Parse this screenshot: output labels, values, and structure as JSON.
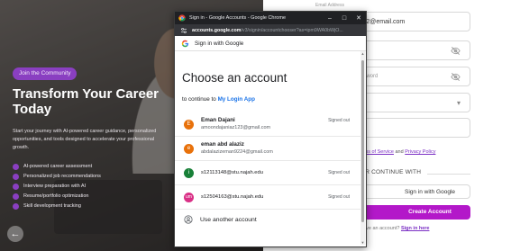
{
  "hero": {
    "badge": "Join the Community",
    "title": "Transform Your Career Today",
    "description": "Start your journey with AI-powered career guidance, personalized opportunities, and tools designed to accelerate your professional growth.",
    "features": [
      "AI-powered career assessment",
      "Personalized job recommendations",
      "Interview preparation with AI",
      "Resume/portfolio optimization",
      "Skill development tracking"
    ],
    "back_icon": "arrow-left-icon",
    "accent_color": "#8a3fc1"
  },
  "form": {
    "email_label_partial": "Email Address",
    "email_value_partial": "ni22@email.com",
    "confirm_placeholder_partial": "assword",
    "fourth_field_partial": "d",
    "terms_link": "Terms of Service",
    "terms_and": "and",
    "privacy_link": "Privacy Policy",
    "or_continue": "OR CONTINUE WITH",
    "google_button": "Sign in with Google",
    "create_button": "Create Account",
    "have_account_partial": "have an account?",
    "sign_in_link": "Sign in here",
    "create_button_color": "#b318c9"
  },
  "popup": {
    "window_title": "Sign in - Google Accounts - Google Chrome",
    "url_host": "accounts.google.com",
    "url_path": "/v3/signin/accountchooser?as=ipm9WA0bWjO...",
    "header": "Sign in with Google",
    "heading": "Choose an account",
    "continue_prefix": "to continue to",
    "app_name": "My Login App",
    "accounts": [
      {
        "initial": "E",
        "name": "Eman Dajani",
        "email": "amoondajaniaz123@gmail.com",
        "status": "Signed out",
        "color": "#e8710a"
      },
      {
        "initial": "e",
        "name": "eman abd alaziz",
        "email": "abdalazizeman9224@gmail.com",
        "status": "",
        "color": "#e8710a"
      },
      {
        "initial": "i",
        "name": "",
        "email": "s12113148@stu.najah.edu",
        "status": "Signed out",
        "color": "#188038"
      },
      {
        "initial": "um",
        "name": "",
        "email": "s12504163@stu.najah.edu",
        "status": "Signed out",
        "color": "#d93086"
      }
    ],
    "use_another": "Use another account"
  }
}
